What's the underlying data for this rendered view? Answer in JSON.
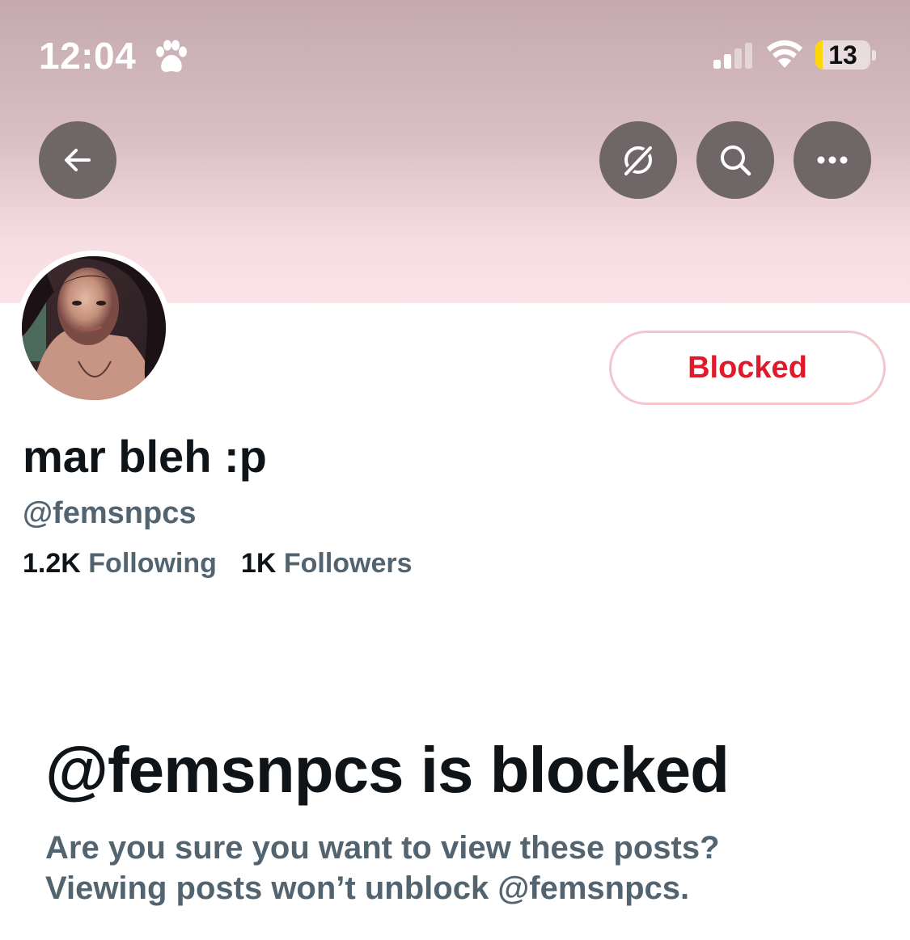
{
  "status_bar": {
    "time": "12:04",
    "battery_percent": "13",
    "battery_level": 0.13,
    "icons": [
      "paw-icon",
      "cellular-signal-icon",
      "wifi-icon",
      "battery-icon"
    ]
  },
  "header": {
    "back_icon": "arrow-left-icon",
    "grok_icon": "grok-icon",
    "search_icon": "search-icon",
    "more_icon": "ellipsis-icon"
  },
  "colors": {
    "banner_top": "#c4a9ae",
    "banner_bottom": "#fbe3e8",
    "blocked_red": "#e01a2a",
    "blocked_border": "#f4c7cf",
    "primary_text": "#0f1419",
    "secondary_text": "#536471",
    "circle_button": "#6f6667"
  },
  "profile": {
    "display_name": "mar bleh :p",
    "handle": "@femsnpcs",
    "following_count": "1.2K",
    "following_label": "Following",
    "followers_count": "1K",
    "followers_label": "Followers",
    "blocked_button_label": "Blocked"
  },
  "blocked_notice": {
    "title": "@femsnpcs is blocked",
    "line1": "Are you sure you want to view these posts?",
    "line2": "Viewing posts won’t unblock @femsnpcs."
  }
}
